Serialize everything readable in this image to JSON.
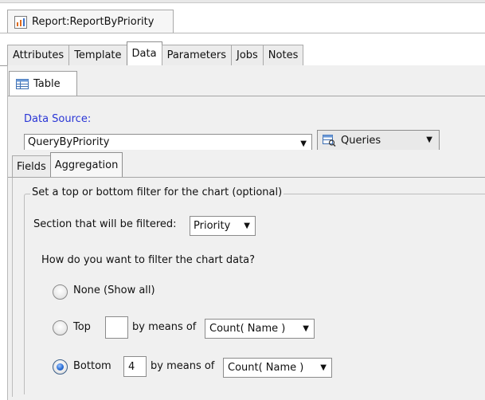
{
  "window": {
    "title": "Report:ReportByPriority",
    "title_icon": "report-chart-icon"
  },
  "tabs": [
    {
      "label": "Attributes",
      "active": false
    },
    {
      "label": "Template",
      "active": false
    },
    {
      "label": "Data",
      "active": true
    },
    {
      "label": "Parameters",
      "active": false
    },
    {
      "label": "Jobs",
      "active": false
    },
    {
      "label": "Notes",
      "active": false
    }
  ],
  "sub_tab": {
    "label": "Table",
    "icon": "table-icon"
  },
  "data_source": {
    "label": "Data Source:",
    "value": "QueryByPriority",
    "queries_label": "Queries",
    "queries_icon": "queries-icon"
  },
  "inner_tabs": [
    {
      "label": "Fields",
      "active": false
    },
    {
      "label": "Aggregation",
      "active": true
    }
  ],
  "filter": {
    "group_title": "Set a top or bottom filter for the chart (optional)",
    "section_label": "Section that will be filtered:",
    "section_value": "Priority",
    "question": "How do you want to filter the chart data?",
    "options": {
      "none": {
        "label": "None (Show all)",
        "checked": false
      },
      "top": {
        "label": "Top",
        "checked": false,
        "count": "",
        "means_label": "by means of",
        "aggregate": "Count( Name )"
      },
      "bottom": {
        "label": "Bottom",
        "checked": true,
        "count": "4",
        "means_label": "by means of",
        "aggregate": "Count( Name )"
      }
    }
  },
  "colors": {
    "link_blue": "#2a36d6",
    "panel_bg": "#f0f0f0",
    "radio_checked": "#2b6fd6"
  }
}
